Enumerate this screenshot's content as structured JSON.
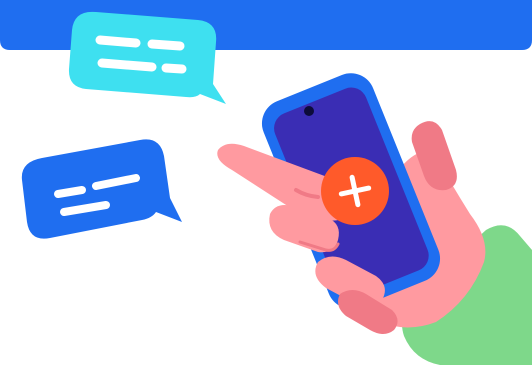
{
  "illustration": {
    "subject": "hand-holding-phone-with-error",
    "colors": {
      "header_band": "#1f6ef0",
      "bubble_cyan": "#3ee0f0",
      "bubble_blue": "#1f6ef0",
      "bubble_lines": "#ffffff",
      "phone_body": "#1f6ef0",
      "phone_screen": "#3a2db4",
      "camera": "#0c0c3a",
      "error_badge": "#ff5a2a",
      "error_cross": "#ffffff",
      "skin": "#ff9aa0",
      "skin_shade": "#f07a86",
      "sleeve": "#7ed88a"
    },
    "icons": [
      "chat-bubble-icon",
      "chat-bubble-icon",
      "close-icon"
    ]
  }
}
